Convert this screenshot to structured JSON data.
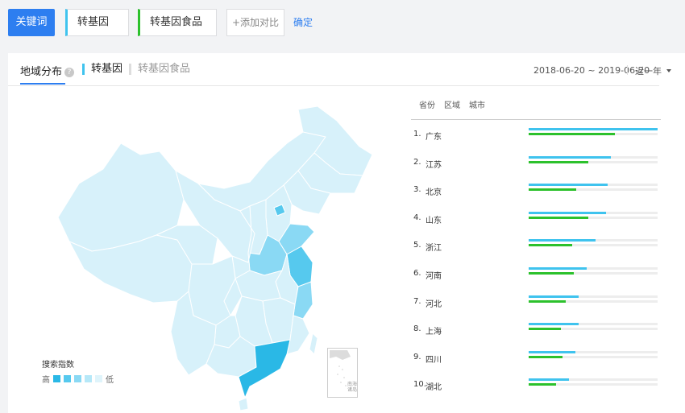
{
  "toolbar": {
    "keyword_button": "关键词",
    "terms": [
      "转基因",
      "转基因食品"
    ],
    "add_compare": "添加对比",
    "confirm": "确定"
  },
  "panel": {
    "tab_title": "地域分布",
    "help_mark": "?",
    "keyword_tabs": [
      "转基因",
      "转基因食品"
    ],
    "date_range": "2018-06-20 ~ 2019-06-20",
    "range_select": "近一年"
  },
  "map": {
    "legend_title": "搜索指数",
    "legend_high": "高",
    "legend_low": "低",
    "legend_colors": [
      "#2ab8e6",
      "#56c9ee",
      "#8ad9f4",
      "#b6e8f8",
      "#dff4fb"
    ],
    "inset_label": "南海诸岛",
    "province_colors": {
      "guangdong": "#2ab8e6",
      "jiangsu": "#56c9ee",
      "beijing": "#56c9ee",
      "shandong": "#8ad9f4",
      "zhejiang": "#8ad9f4",
      "henan": "#8ad9f4",
      "default": "#d7f1fa"
    }
  },
  "ranking": {
    "tabs": [
      "省份",
      "区域",
      "城市"
    ],
    "rows": [
      {
        "rank": "1.",
        "name": "广东",
        "a": 1.0,
        "b": 0.67
      },
      {
        "rank": "2.",
        "name": "江苏",
        "a": 0.64,
        "b": 0.46
      },
      {
        "rank": "3.",
        "name": "北京",
        "a": 0.61,
        "b": 0.37
      },
      {
        "rank": "4.",
        "name": "山东",
        "a": 0.6,
        "b": 0.46
      },
      {
        "rank": "5.",
        "name": "浙江",
        "a": 0.52,
        "b": 0.34
      },
      {
        "rank": "6.",
        "name": "河南",
        "a": 0.45,
        "b": 0.35
      },
      {
        "rank": "7.",
        "name": "河北",
        "a": 0.39,
        "b": 0.29
      },
      {
        "rank": "8.",
        "name": "上海",
        "a": 0.39,
        "b": 0.25
      },
      {
        "rank": "9.",
        "name": "四川",
        "a": 0.36,
        "b": 0.26
      },
      {
        "rank": "10.",
        "name": "湖北",
        "a": 0.31,
        "b": 0.21
      }
    ]
  }
}
